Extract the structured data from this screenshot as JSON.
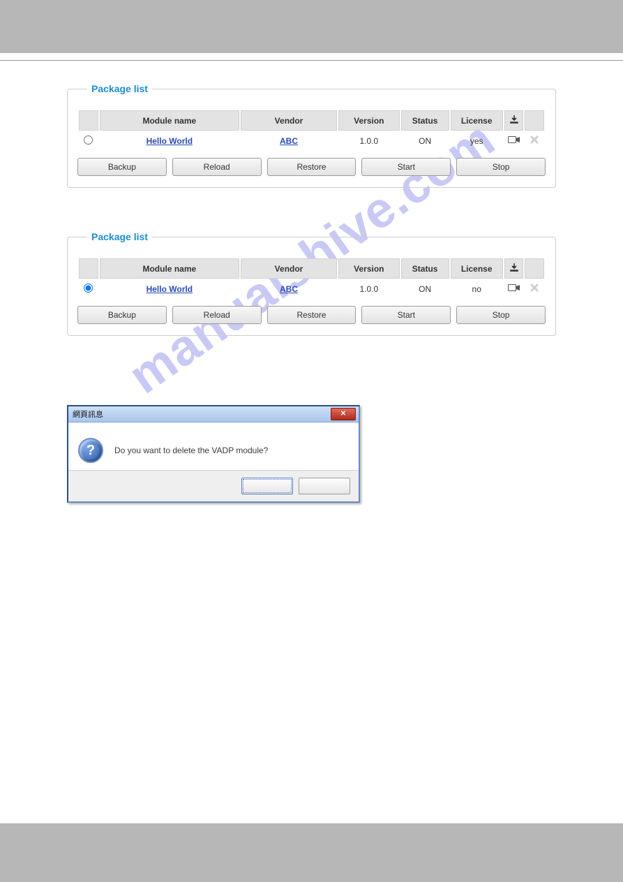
{
  "watermark": "manualshive.com",
  "columns": {
    "module": "Module name",
    "vendor": "Vendor",
    "version": "Version",
    "status": "Status",
    "license": "License"
  },
  "buttons": {
    "backup": "Backup",
    "reload": "Reload",
    "restore": "Restore",
    "start": "Start",
    "stop": "Stop"
  },
  "panels": [
    {
      "title": "Package list",
      "rows": [
        {
          "selected": false,
          "module": "Hello World",
          "vendor": "ABC",
          "version": "1.0.0",
          "status": "ON",
          "license": "yes"
        }
      ]
    },
    {
      "title": "Package list",
      "rows": [
        {
          "selected": true,
          "module": "Hello World",
          "vendor": "ABC",
          "version": "1.0.0",
          "status": "ON",
          "license": "no"
        }
      ]
    }
  ],
  "dialog": {
    "title": "網頁訊息",
    "message": "Do you want to delete the VADP module?"
  }
}
